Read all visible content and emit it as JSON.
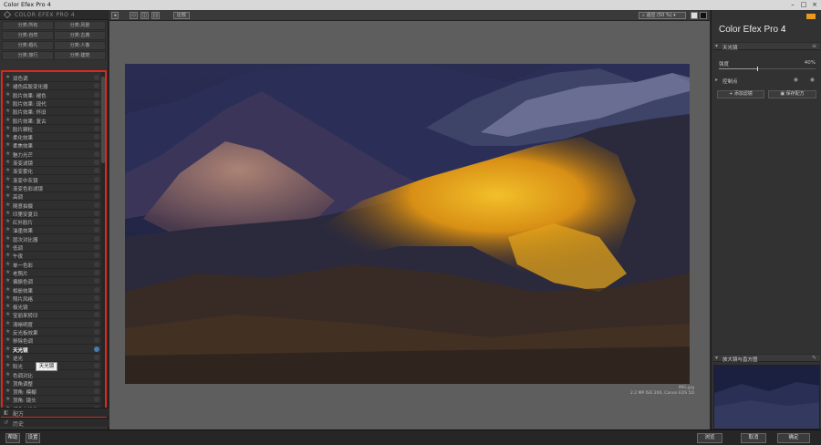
{
  "window": {
    "title": "Color Efex Pro 4"
  },
  "left_panel": {
    "brand": "COLOR EFEX PRO 4",
    "categories": [
      "分类:所有",
      "分类:风景",
      "分类:自然",
      "分类:古典",
      "分类:婚礼",
      "分类:人像",
      "分类:旅行",
      "分类:建筑"
    ],
    "filters": [
      {
        "label": "双色调"
      },
      {
        "label": "褪色底胶变化器"
      },
      {
        "label": "胶片效果: 褪色"
      },
      {
        "label": "胶片效果: 现代"
      },
      {
        "label": "胶片效果: 怀旧"
      },
      {
        "label": "胶片效果: 复古"
      },
      {
        "label": "胶片颗粒"
      },
      {
        "label": "柔化效果"
      },
      {
        "label": "柔焦效果"
      },
      {
        "label": "魅力光芒"
      },
      {
        "label": "渐变滤镜"
      },
      {
        "label": "渐变雾化"
      },
      {
        "label": "渐变中灰镜"
      },
      {
        "label": "渐变色彩滤镜"
      },
      {
        "label": "高调"
      },
      {
        "label": "随意拍摄"
      },
      {
        "label": "印第安夏日"
      },
      {
        "label": "红外胶片"
      },
      {
        "label": "油墨效果"
      },
      {
        "label": "层次对比器"
      },
      {
        "label": "低调"
      },
      {
        "label": "午夜"
      },
      {
        "label": "单一色彩"
      },
      {
        "label": "老照片"
      },
      {
        "label": "偏振色调"
      },
      {
        "label": "相册效果"
      },
      {
        "label": "照片风格"
      },
      {
        "label": "极光镜"
      },
      {
        "label": "宝丽来转印"
      },
      {
        "label": "清晰明度"
      },
      {
        "label": "反光板效果"
      },
      {
        "label": "移除色调"
      },
      {
        "label": "天光镜"
      },
      {
        "label": "逆光"
      },
      {
        "label": "阳光"
      },
      {
        "label": "色调对比"
      },
      {
        "label": "顶角调整"
      },
      {
        "label": "顶角: 模糊"
      },
      {
        "label": "顶角: 镜头"
      },
      {
        "label": "褪色中性化"
      }
    ],
    "selected_index": 32,
    "tooltip": "天光镜",
    "footer": [
      {
        "icon": "recipe-icon",
        "label": "配方"
      },
      {
        "icon": "history-icon",
        "label": "历史"
      }
    ],
    "buttons": {
      "help": "帮助",
      "settings": "设置"
    }
  },
  "toolbar": {
    "compare_label": "比较",
    "zoom_label": "适应 (50 %)"
  },
  "photo": {
    "filename": "IMG.jpg",
    "info": "2.2 MP ISO 200, Canon EOS 5D"
  },
  "right_panel": {
    "title_main": "Color Efex Pro",
    "title_version": "4",
    "filter_name": "天光镜",
    "strength_label": "强度",
    "strength_value": "40%",
    "strength_fraction": 0.4,
    "control_points_label": "控制点",
    "add_filter_label": "添加滤镜",
    "save_recipe_label": "保存配方",
    "loupe_label": "放大镜与直方图"
  },
  "bottom": {
    "browse": "浏览",
    "cancel": "取消",
    "ok": "确定"
  },
  "colors": {
    "highlight": "#e1251b",
    "accent": "#e79a1f",
    "sky": "#1b1e33",
    "gold": "#e4a21a"
  }
}
